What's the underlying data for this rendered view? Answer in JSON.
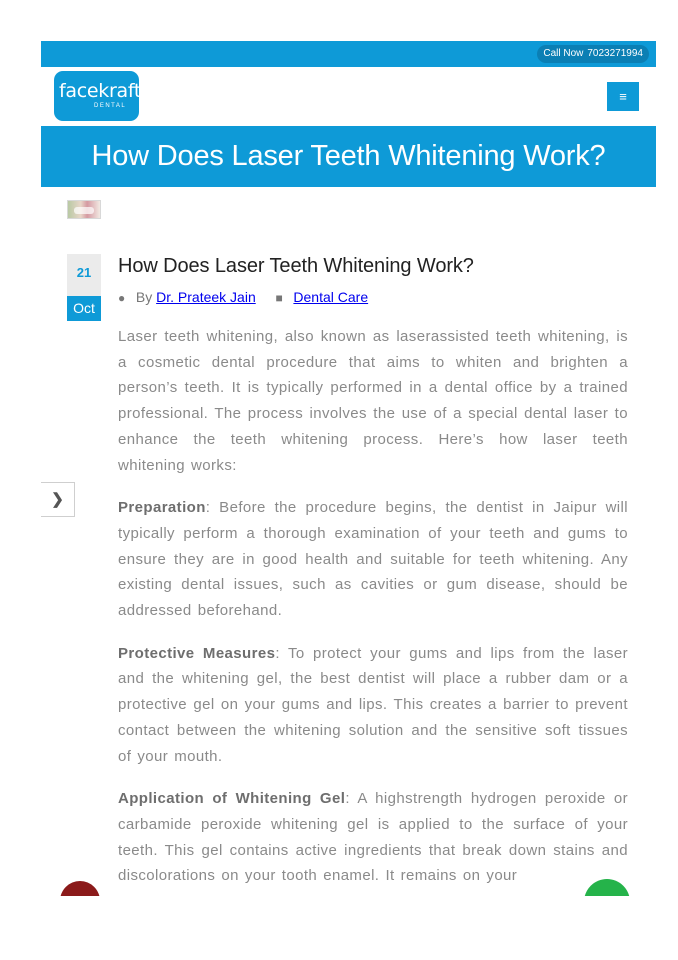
{
  "topbar": {
    "call_label": "Call Now",
    "phone": "7023271994"
  },
  "header": {
    "logo_text": "facekraft",
    "logo_sub": "DENTAL",
    "menu_icon": "≡"
  },
  "banner": {
    "title": "How Does Laser Teeth Whitening Work?"
  },
  "post": {
    "date_day": "21",
    "date_month": "Oct",
    "title": "How Does Laser Teeth Whitening Work?",
    "by_label": "By",
    "author": "Dr. Prateek Jain",
    "category": "Dental Care",
    "intro": "Laser teeth whitening, also known as laserassisted teeth whitening, is a cosmetic dental procedure that aims to whiten and brighten a person’s teeth. It is typically performed in a dental office by a trained professional. The process involves the use of a special dental laser to enhance the teeth whitening process. Here’s how laser teeth whitening works:",
    "sections": [
      {
        "heading": "Preparation",
        "text": ": Before the procedure begins, the dentist in Jaipur will typically perform a thorough examination of your teeth and gums to ensure they are in good health and suitable for teeth whitening. Any existing dental issues, such as cavities or gum disease, should be addressed beforehand."
      },
      {
        "heading": "Protective Measures",
        "text": ": To protect your gums and lips from the laser and the whitening gel, the best dentist will place a rubber dam or a protective gel on your gums and lips. This creates a barrier to prevent contact between the whitening solution and the sensitive soft tissues of your mouth."
      },
      {
        "heading": "Application of Whitening Gel",
        "text": ": A highstrength hydrogen peroxide or carbamide peroxide whitening gel is applied to the surface of your teeth. This gel contains active ingredients that break down stains and discolorations on your tooth enamel. It remains on your"
      }
    ]
  },
  "icons": {
    "user": "user-icon",
    "folder": "folder-icon",
    "next": "chevron-right-icon"
  },
  "colors": {
    "brand": "#0e9ad7",
    "text": "#8a8a8a",
    "title": "#222222"
  }
}
